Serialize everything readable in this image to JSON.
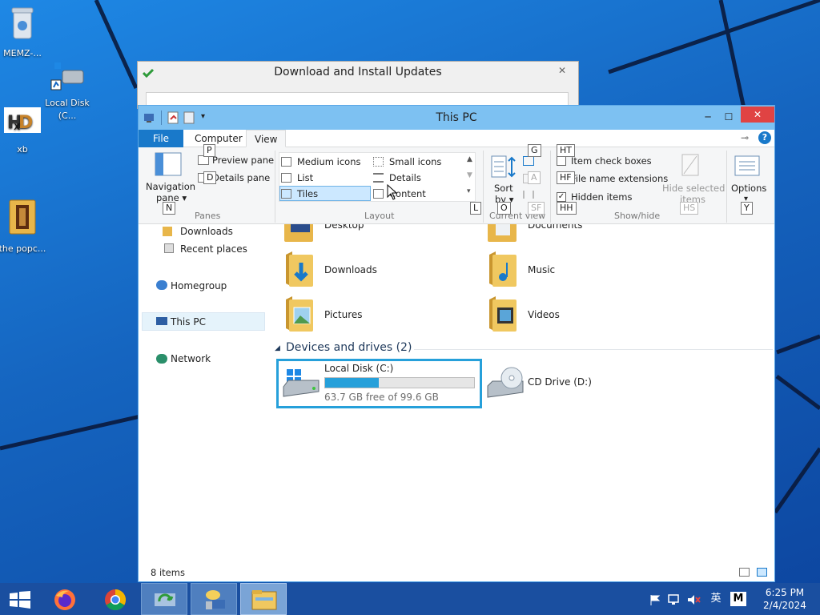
{
  "desktop": {
    "icons": [
      {
        "name": "recycle-bin",
        "label": "MEMZ-..."
      },
      {
        "name": "local-disk-shortcut",
        "label": "Local Disk (C..."
      },
      {
        "name": "xb-app",
        "label": "xb"
      },
      {
        "name": "popcorn-folder",
        "label": "the popc..."
      }
    ]
  },
  "update_window": {
    "title": "Download and Install Updates",
    "close": "✕"
  },
  "explorer": {
    "title": "This PC",
    "controls": {
      "minimize": "─",
      "maximize": "☐",
      "close": "✕"
    },
    "tabs": {
      "file": "File",
      "computer": "Computer",
      "view": "View"
    },
    "ribbon": {
      "panes": {
        "navigation_pane": "Navigation",
        "navigation_pane2": "pane ▾",
        "preview_pane": "Preview pane",
        "details_pane": "Details pane",
        "label": "Panes"
      },
      "layout": {
        "medium_icons": "Medium icons",
        "small_icons": "Small icons",
        "list": "List",
        "details": "Details",
        "tiles": "Tiles",
        "content": "Content",
        "label": "Layout"
      },
      "current_view": {
        "sort": "Sort",
        "sort2": "by ▾",
        "label": "Current view"
      },
      "show_hide": {
        "item_check_boxes": "Item check boxes",
        "file_name_extensions": "File name extensions",
        "hidden_items": "Hidden items",
        "hide_selected": "Hide selected",
        "hide_selected2": "items",
        "label": "Show/hide"
      },
      "options": {
        "label": "Options",
        "arrow": "▾"
      }
    },
    "keytips": {
      "p": "P",
      "d": "D",
      "n": "N",
      "l": "L",
      "g": "G",
      "a": "A",
      "o": "O",
      "sf": "SF",
      "ht": "HT",
      "hf": "HF",
      "hh": "HH",
      "hs": "HS",
      "y": "Y"
    },
    "nav": {
      "downloads": "Downloads",
      "recent": "Recent places",
      "homegroup": "Homegroup",
      "thispc": "This PC",
      "network": "Network"
    },
    "folders": {
      "desktop": "Desktop",
      "documents": "Documents",
      "downloads": "Downloads",
      "music": "Music",
      "pictures": "Pictures",
      "videos": "Videos"
    },
    "devices": {
      "header": "Devices and drives (2)",
      "c_name": "Local Disk (C:)",
      "c_free": "63.7 GB free of 99.6 GB",
      "c_used_fraction": 0.36,
      "d_name": "CD Drive (D:)"
    },
    "status": {
      "items": "8 items"
    }
  },
  "taskbar": {
    "time": "6:25 PM",
    "date": "2/4/2024",
    "ime": "英",
    "m": "M"
  },
  "colors": {
    "accent": "#1979ca",
    "select_border": "#26a0da",
    "progress": "#26a0da",
    "close_red": "#e04343"
  }
}
